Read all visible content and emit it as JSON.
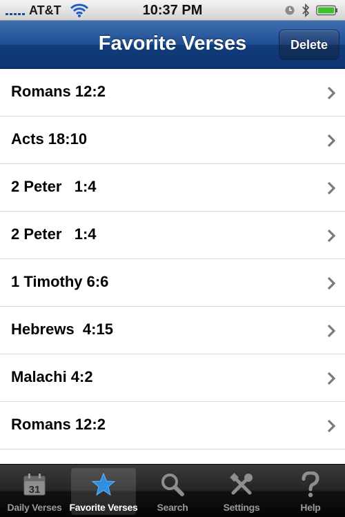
{
  "status_bar": {
    "carrier": "AT&T",
    "time": "10:37 PM"
  },
  "nav": {
    "title": "Favorite Verses",
    "delete_label": "Delete"
  },
  "verses": [
    "Romans 12:2",
    "Acts 18:10",
    "2 Peter   1:4",
    "2 Peter   1:4",
    "1 Timothy 6:6",
    "Hebrews  4:15",
    "Malachi 4:2",
    "Romans 12:2"
  ],
  "tabs": [
    {
      "label": "Daily Verses",
      "icon": "calendar-icon",
      "calendar_day": "31"
    },
    {
      "label": "Favorite Verses",
      "icon": "star-icon",
      "selected": true
    },
    {
      "label": "Search",
      "icon": "magnifier-icon"
    },
    {
      "label": "Settings",
      "icon": "tools-icon"
    },
    {
      "label": "Help",
      "icon": "question-icon"
    }
  ],
  "colors": {
    "nav_blue": "#1f4f93",
    "selected_star": "#2f8fe0",
    "tab_inactive": "#9a9a9a"
  }
}
